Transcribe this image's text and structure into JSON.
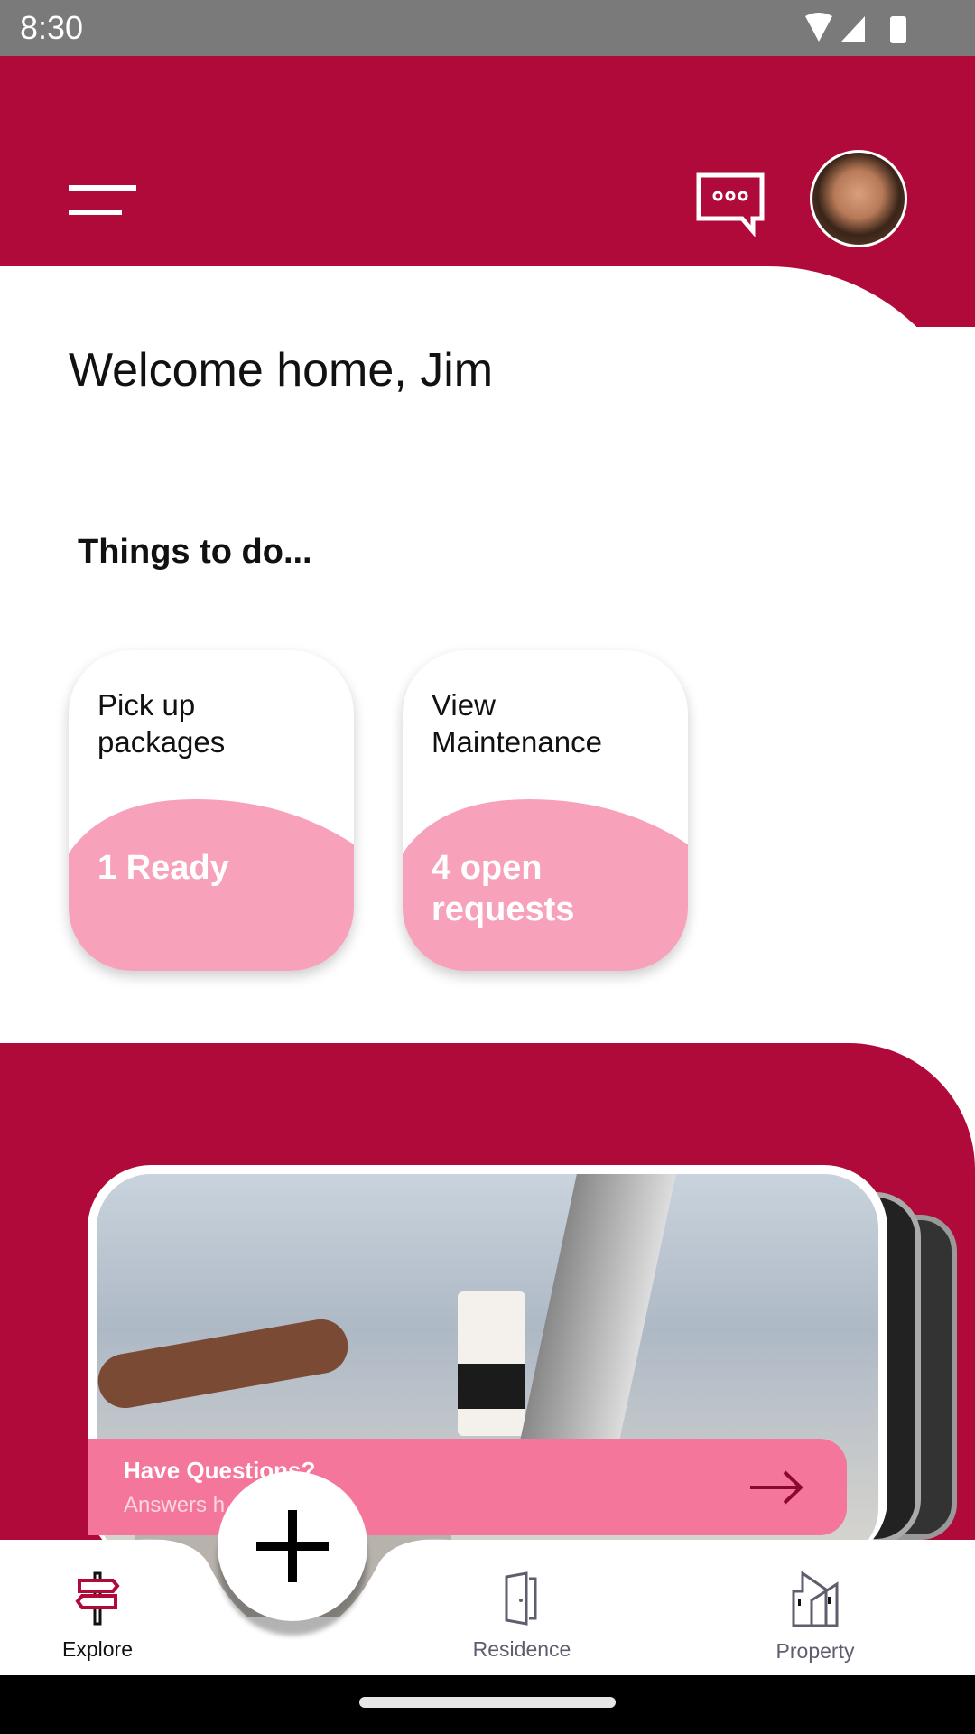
{
  "status_bar": {
    "time": "8:30",
    "icons": [
      "wifi-icon",
      "signal-icon",
      "battery-icon"
    ]
  },
  "header": {
    "menu_icon": "hamburger-icon",
    "chat_icon": "chat-bubble-icon",
    "avatar": "user-avatar"
  },
  "welcome": "Welcome home, Jim",
  "things_title": "Things to do...",
  "cards": [
    {
      "title": "Pick up packages",
      "status": "1 Ready"
    },
    {
      "title": "View Maintenance",
      "status": "4 open requests"
    }
  ],
  "promo": {
    "title": "Have Questions?",
    "subtitle": "Answers h"
  },
  "nav": {
    "items": [
      {
        "label": "Explore",
        "icon": "signpost-icon",
        "active": true
      },
      {
        "label": "Residence",
        "icon": "door-icon"
      },
      {
        "label": "Property",
        "icon": "buildings-icon"
      }
    ],
    "fab_icon": "plus-icon"
  },
  "colors": {
    "brand": "#b00a3a",
    "card_accent": "#f7a1bb",
    "banner": "#f4769a",
    "nav_active": "#b00a3a",
    "nav_inactive": "#5e5e6e"
  }
}
